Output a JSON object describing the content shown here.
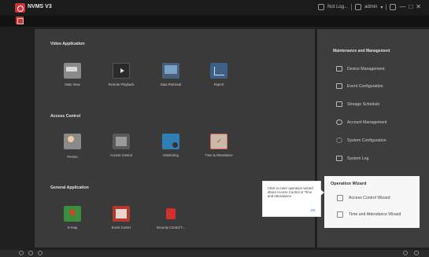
{
  "titlebar": {
    "app_title": "NVMS V3",
    "right_text": "Not Log...",
    "user": "admin",
    "user_caret": "▾",
    "minimize": "—",
    "maximize": "□",
    "close": "✕"
  },
  "sections": {
    "video": {
      "title": "Video Application",
      "tiles": [
        {
          "label": "Main View",
          "icon": "camera-icon"
        },
        {
          "label": "Remote Playback",
          "icon": "playback-icon"
        },
        {
          "label": "Data Retrieval",
          "icon": "data-retrieval-icon"
        },
        {
          "label": "Report",
          "icon": "report-icon"
        }
      ]
    },
    "access": {
      "title": "Access Control",
      "tiles": [
        {
          "label": "Person",
          "icon": "person-icon"
        },
        {
          "label": "Access Control",
          "icon": "access-control-icon"
        },
        {
          "label": "Monitoring",
          "icon": "monitoring-icon"
        },
        {
          "label": "Time & Attendance",
          "icon": "time-attendance-icon"
        }
      ]
    },
    "general": {
      "title": "General Application",
      "tiles": [
        {
          "label": "E-map",
          "icon": "emap-icon"
        },
        {
          "label": "Event Center",
          "icon": "event-center-icon"
        },
        {
          "label": "Security Control T...",
          "icon": "security-control-icon"
        }
      ]
    }
  },
  "maintenance": {
    "title": "Maintenance and Management",
    "items": [
      {
        "label": "Device Management",
        "icon": "device-icon"
      },
      {
        "label": "Event Configuration",
        "icon": "event-config-icon"
      },
      {
        "label": "Storage Schedule",
        "icon": "storage-icon"
      },
      {
        "label": "Account Management",
        "icon": "account-icon"
      },
      {
        "label": "System Configuration",
        "icon": "gear-icon"
      },
      {
        "label": "System Log",
        "icon": "log-icon"
      }
    ]
  },
  "wizard": {
    "title": "Operation Wizard",
    "items": [
      {
        "label": "Access Control Wizard",
        "icon": "access-wizard-icon"
      },
      {
        "label": "Time and Attendance Wizard",
        "icon": "attendance-wizard-icon"
      }
    ]
  },
  "tooltip": {
    "text": "Click to enter operation wizard about Access Control or Time and Attendance.",
    "ok": "OK"
  }
}
